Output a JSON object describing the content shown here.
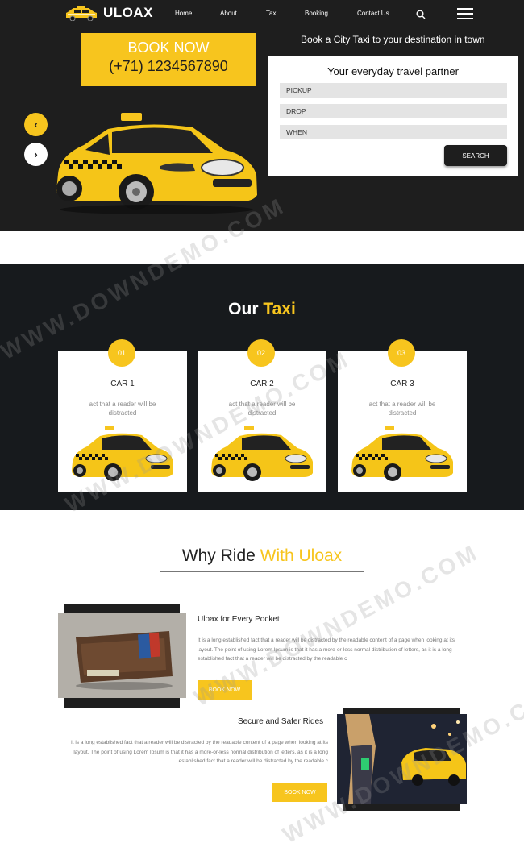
{
  "brand": {
    "name": "ULOAX",
    "accent": "#f7c51e",
    "dark": "#1e1e1e"
  },
  "nav": {
    "items": [
      "Home",
      "About",
      "Taxi",
      "Booking",
      "Contact Us"
    ]
  },
  "hero": {
    "book_now": "BOOK NOW",
    "phone": "(+71) 1234567890",
    "tagline": "Book a City Taxi to your destination in town",
    "form_title": "Your everyday travel partner",
    "fields": [
      "PICKUP",
      "DROP",
      "WHEN"
    ],
    "search_label": "SEARCH",
    "prev_icon": "chevron-left-icon",
    "next_icon": "chevron-right-icon"
  },
  "taxi": {
    "title_part1": "Our ",
    "title_part2": "Taxi",
    "cards": [
      {
        "num": "01",
        "name": "CAR 1",
        "text": "act that a reader will be distracted"
      },
      {
        "num": "02",
        "name": "CAR 2",
        "text": "act that a reader will be distracted"
      },
      {
        "num": "03",
        "name": "CAR 3",
        "text": "act that a reader will be distracted"
      }
    ]
  },
  "why": {
    "title_part1": "Why Ride ",
    "title_part2": "With Uloax",
    "features": [
      {
        "title": "Uloax for Every Pocket",
        "text": "It is a long established fact that a reader will be distracted by the readable content of a page when looking at its layout. The point of using Lorem Ipsum is that it has a more-or-less normal distribution of letters, as it is a long established fact that a reader will be distracted by the readable c",
        "button": "BOOK NOW"
      },
      {
        "title": "Secure and Safer Rides",
        "text": "It is a long established fact that a reader will be distracted by the readable content of a page when looking at its layout. The point of using Lorem Ipsum is that it has a more-or-less normal distribution of letters, as it is a long established fact that a reader will be distracted by the readable c",
        "button": "BOOK NOW"
      }
    ]
  },
  "watermark": "WWW.DOWNDEMO.COM"
}
